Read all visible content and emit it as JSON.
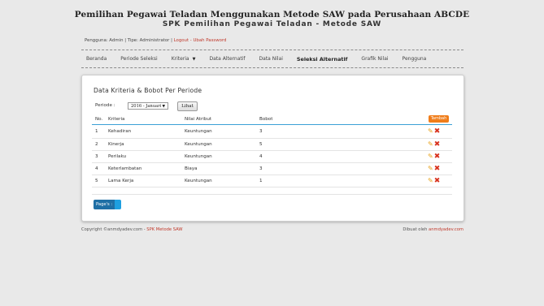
{
  "header": {
    "title": "Pemilihan Pegawai Teladan Menggunakan Metode SAW pada Perusahaan ABCDE",
    "subtitle": "SPK Pemilihan Pegawai Teladan - Metode SAW"
  },
  "userbar": {
    "user_label": "Pengguna: Admin",
    "separator1": " | ",
    "type_label": "Tipe: Administrator",
    "separator2": " | ",
    "logout": "Logout",
    "separator3": " - ",
    "change_password": "Ubah Password"
  },
  "nav": {
    "items": [
      {
        "label": "Beranda"
      },
      {
        "label": "Periode Seleksi"
      },
      {
        "label": "Kriteria"
      },
      {
        "label": "Data Alternatif"
      },
      {
        "label": "Data Nilai"
      },
      {
        "label": "Seleksi Alternatif"
      },
      {
        "label": "Grafik Nilai"
      },
      {
        "label": "Pengguna"
      }
    ],
    "active": "Seleksi Alternatif"
  },
  "panel": {
    "title": "Data Kriteria & Bobot Per Periode",
    "periode_label": "Periode :",
    "periode_selected": "2016 - Januari",
    "lihat_label": "Lihat",
    "tambah_label": "Tambah",
    "columns": [
      "No.",
      "Kriteria",
      "Nilai Atribut",
      "Bobot"
    ],
    "rows": [
      {
        "no": "1",
        "kriteria": "Kehadiran",
        "atribut": "Keuntungan",
        "bobot": "3"
      },
      {
        "no": "2",
        "kriteria": "Kinerja",
        "atribut": "Keuntungan",
        "bobot": "5"
      },
      {
        "no": "3",
        "kriteria": "Perilaku",
        "atribut": "Keuntungan",
        "bobot": "4"
      },
      {
        "no": "4",
        "kriteria": "Keterlambatan",
        "atribut": "Biaya",
        "bobot": "3"
      },
      {
        "no": "5",
        "kriteria": "Lama Kerja",
        "atribut": "Keuntungan",
        "bobot": "1"
      }
    ],
    "pages_label": "Page's :"
  },
  "footer": {
    "copyright": "Copyright ©anmdyadev.com - ",
    "copyright_link": "SPK Metode SAW",
    "credit": "Dibuat oleh ",
    "credit_link": "anmdyadev.com"
  },
  "icons": {
    "edit": "pencil-icon",
    "delete": "cross-icon",
    "dropdown": "caret-down-icon"
  },
  "colors": {
    "accent_link": "#c0392b",
    "tambah_button": "#f07d1a",
    "table_header_line": "#3ba0d6",
    "pencil": "#e8a21a",
    "delete": "#d8331f",
    "pager": "#1f6fa5"
  }
}
